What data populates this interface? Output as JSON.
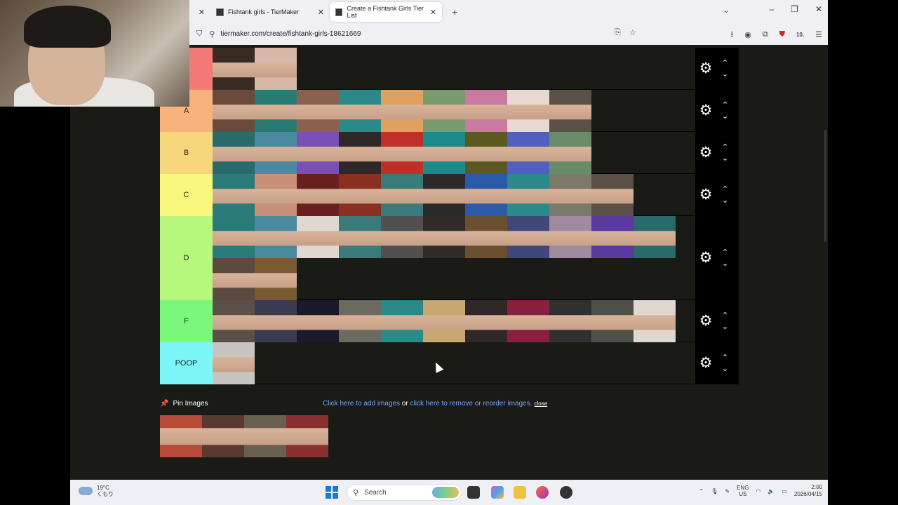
{
  "browser": {
    "tabs": [
      {
        "title": "Fishtank girls - TierMaker"
      },
      {
        "title": "Create a Fishtank Girls Tier List"
      }
    ],
    "new_tab": "+",
    "url": "tiermaker.com/create/fishtank-girls-18621669",
    "ext_badge": "10."
  },
  "tiers": [
    {
      "label": "",
      "color": "#f47a7a",
      "items": [
        "#3a2a24",
        "#d8b8a8"
      ],
      "rows": 1
    },
    {
      "label": "A",
      "color": "#f7b37b",
      "items": [
        "#6a4a3a",
        "#2a7a74",
        "#8a6050",
        "#2a8a8a",
        "#e0a060",
        "#7a9a70",
        "#c87aa0",
        "#e8d8d0",
        "#5a5048"
      ],
      "rows": 1
    },
    {
      "label": "B",
      "color": "#f7d77b",
      "items": [
        "#2a6a6a",
        "#4a8aa0",
        "#7a50b8",
        "#302828",
        "#c0302a",
        "#1a8a8a",
        "#5a5a20",
        "#5060c0",
        "#6a8a6a"
      ],
      "rows": 1
    },
    {
      "label": "C",
      "color": "#f7f77b",
      "items": [
        "#2a7a7a",
        "#c89078",
        "#6a2020",
        "#8a3020",
        "#3a7a7a",
        "#2a2a2a",
        "#2a5aa8",
        "#2a8a8a",
        "#7a7a6a",
        "#5a5048"
      ],
      "rows": 1
    },
    {
      "label": "D",
      "color": "#b7f77b",
      "items": [
        "#2a7a7a",
        "#4a8aa0",
        "#e0d8d0",
        "#3a7a7a",
        "#505050",
        "#302a28",
        "#6a5030",
        "#40487a",
        "#a08aa0",
        "#5a3aa0",
        "#2a6a6a",
        "#5a4a40",
        "#7a5a30"
      ],
      "rows": 2
    },
    {
      "label": "F",
      "color": "#7bf77b",
      "items": [
        "#5a5048",
        "#3a3a50",
        "#1a1a2a",
        "#6a6a60",
        "#2a8a8a",
        "#c8a870",
        "#302828",
        "#8a2040",
        "#303030",
        "#50504a",
        "#e0d8d0"
      ],
      "rows": 1
    },
    {
      "label": "POOP",
      "color": "#7bf7f7",
      "items": [
        "#c8c4c0"
      ],
      "rows": 1
    }
  ],
  "controls": {
    "up": "⌃",
    "down": "⌄",
    "gear": "⚙"
  },
  "pin": {
    "label": "Pin Images"
  },
  "links": {
    "add": "Click here to add images",
    "or": " or ",
    "remove": "click here to remove or reorder images.",
    "close": "close"
  },
  "pool": {
    "items": [
      "#b84a3a",
      "#5a3a30",
      "#6a6050",
      "#8a3030"
    ]
  },
  "taskbar": {
    "weather_temp": "19°C",
    "weather_desc": "くもり",
    "search": "Search",
    "lang1": "ENG",
    "lang2": "US",
    "time": "2:00",
    "date": "2026/04/15"
  }
}
